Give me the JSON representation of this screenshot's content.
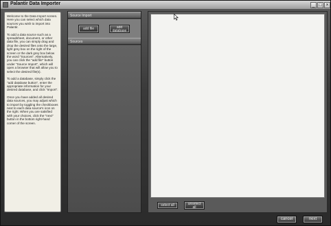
{
  "window": {
    "title": "Palantir Data Importer",
    "controls": {
      "minimize": "_",
      "maximize": "□",
      "close": "×"
    }
  },
  "instructions": {
    "paragraphs": [
      "Welcome to the Data Import screen. Here you can select which data sources you wish to import into Palantir.",
      "To add a data source such as a spreadsheet, document, or other data file, you can simply drag and drop the desired files onto the large, light grey box on the right of the screen or the dark grey box below the word \"Sources\". Alternatively, you can click the \"add file\" button under \"Source Import\", which will open a browser that will allow you to select the desired file(s).",
      "To add a database, simply click the \"add database button\", enter the appropriate information for your desired database, and click \"Import\".",
      "Once you have added all desired data sources, you may adjust which to import by toggling the checkboxes next to each data source's icon on the right. When you are satisfied with your choices, click the \"next\" button in the bottom right-hand corner of the screen."
    ]
  },
  "source_import": {
    "header": "Source Import",
    "add_file_label": "add file",
    "add_database_line1": "add",
    "add_database_line2": "database"
  },
  "sources": {
    "header": "Sources"
  },
  "selection": {
    "select_all_label": "select all",
    "unselect_all_line1": "unselect",
    "unselect_all_line2": "all"
  },
  "footer": {
    "cancel_label": "cancel",
    "next_label": "next"
  },
  "icons": {
    "app": "app-icon",
    "cursor": "mouse-pointer-icon"
  }
}
